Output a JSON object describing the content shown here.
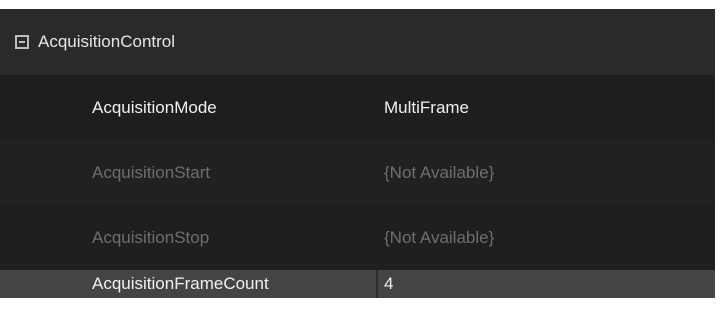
{
  "category": {
    "label": "AcquisitionControl",
    "expander_icon": "collapse-minus-icon"
  },
  "properties": [
    {
      "name": "AcquisitionMode",
      "value": "MultiFrame",
      "enabled": true
    },
    {
      "name": "AcquisitionStart",
      "value": "{Not Available}",
      "enabled": false
    },
    {
      "name": "AcquisitionStop",
      "value": "{Not Available}",
      "enabled": false
    },
    {
      "name": "AcquisitionFrameCount",
      "value": "4",
      "enabled": true,
      "selected": true
    }
  ],
  "colors": {
    "panel_background": "#232323",
    "category_background": "#2a2a2a",
    "selected_row_background": "#444444",
    "enabled_text": "#f0f0f0",
    "disabled_text": "#6e6e6e"
  }
}
